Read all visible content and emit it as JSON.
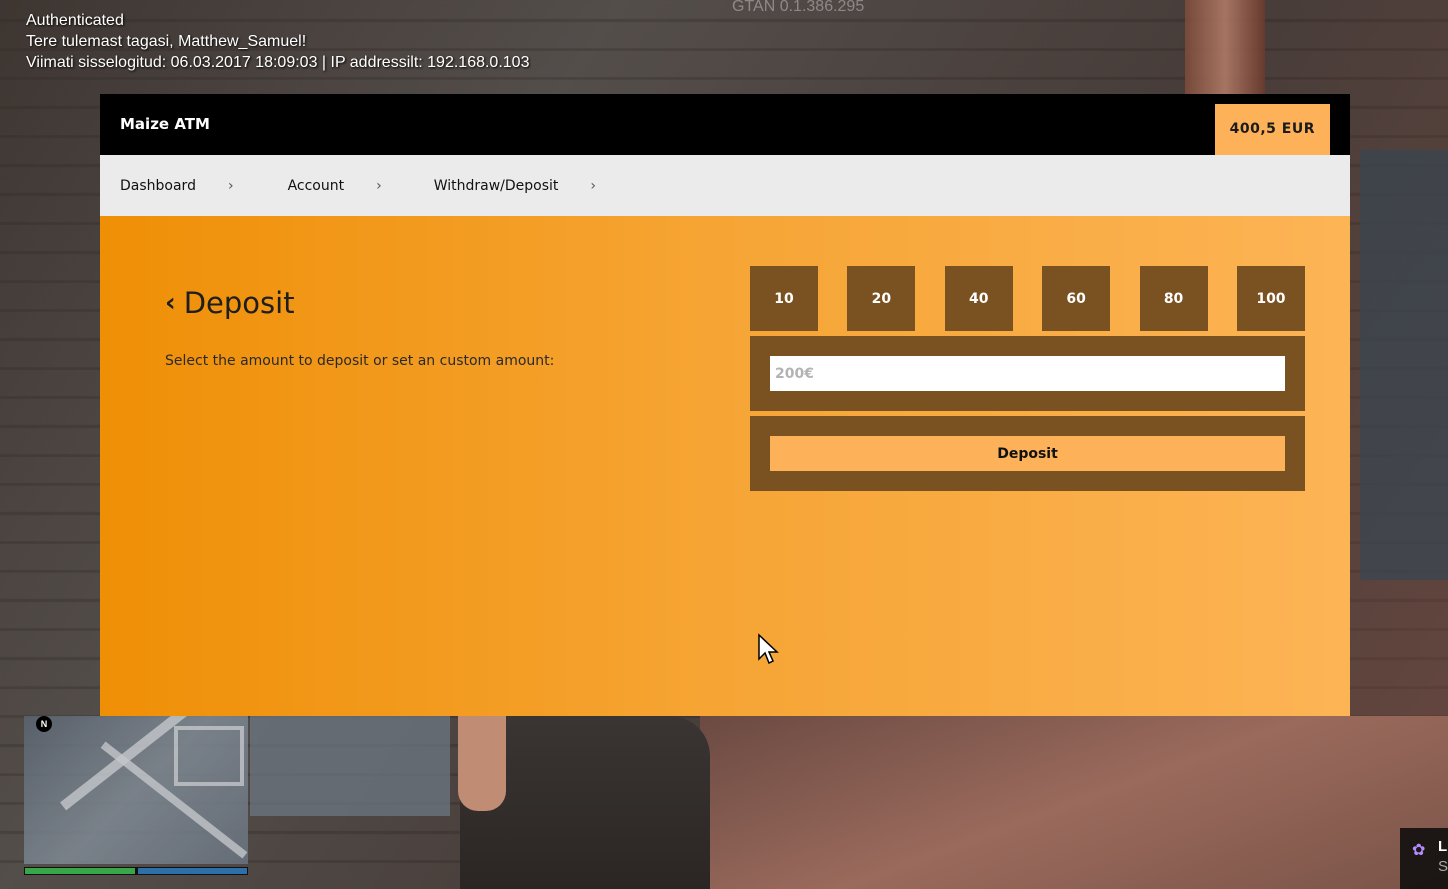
{
  "hud": {
    "line1": "Authenticated",
    "line2": "Tere tulemast tagasi, Matthew_Samuel!",
    "line3": "Viimati sisselogitud: 06.03.2017 18:09:03 | IP addressilt: 192.168.0.103",
    "version": "GTAN 0.1.386.295"
  },
  "atm": {
    "title": "Maize ATM",
    "balance": "400,5 EUR",
    "breadcrumb": [
      {
        "label": "Dashboard"
      },
      {
        "label": "Account"
      },
      {
        "label": "Withdraw/Deposit"
      }
    ],
    "heading": "Deposit",
    "description": "Select the amount to deposit or set an custom amount:",
    "amounts": [
      "10",
      "20",
      "40",
      "60",
      "80",
      "100"
    ],
    "custom_placeholder": "200€",
    "deposit_button": "Deposit"
  },
  "minimap": {
    "compass": "N",
    "health": 0.5
  },
  "notification": {
    "title": "Li",
    "subtitle": "S"
  },
  "colors": {
    "accent": "#fdb259",
    "panel": "#7a5121",
    "gradient_start": "#ef8f06",
    "gradient_end": "#fdb455"
  }
}
